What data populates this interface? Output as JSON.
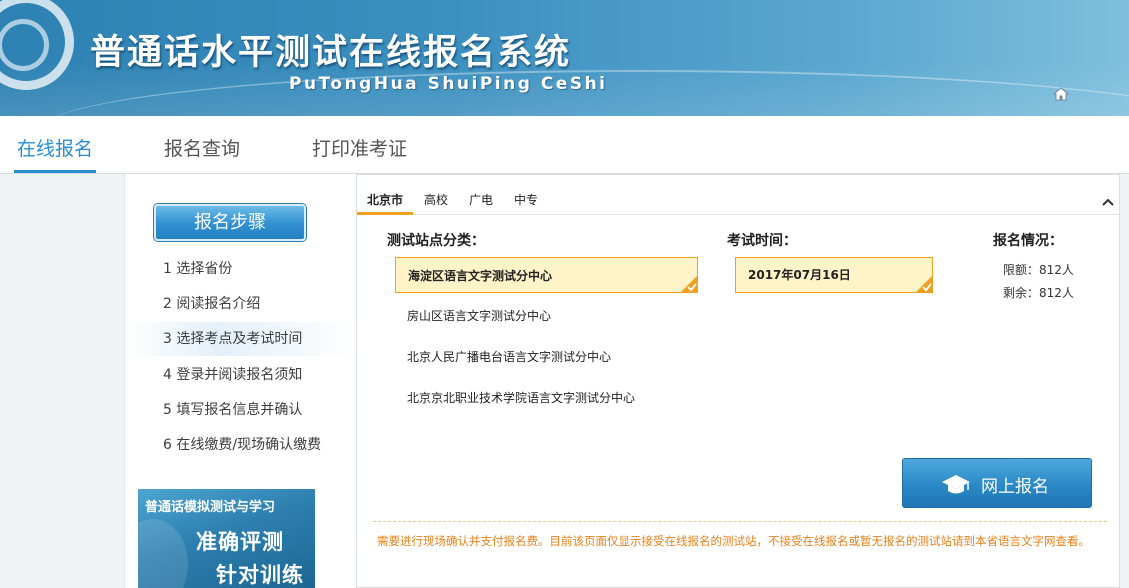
{
  "header": {
    "title": "普通话水平测试在线报名系统",
    "subtitle": "PuTongHua ShuiPing CeShi",
    "home_icon": "home-icon"
  },
  "nav": {
    "tabs": [
      {
        "label": "在线报名",
        "active": true
      },
      {
        "label": "报名查询",
        "active": false
      },
      {
        "label": "打印准考证",
        "active": false
      }
    ],
    "accent_color": "#2a8ed0"
  },
  "sidebar": {
    "steps_button": "报名步骤",
    "steps": [
      {
        "label": "1 选择省份",
        "active": false
      },
      {
        "label": "2 阅读报名介绍",
        "active": false
      },
      {
        "label": "3 选择考点及考试时间",
        "active": true
      },
      {
        "label": "4 登录并阅读报名须知",
        "active": false
      },
      {
        "label": "5 填写报名信息并确认",
        "active": false
      },
      {
        "label": "6 在线缴费/现场确认缴费",
        "active": false
      }
    ],
    "promo": {
      "top": "普通话模拟测试与学习",
      "line1": "准确评测",
      "line2": "针对训练"
    }
  },
  "main": {
    "region_tabs": [
      {
        "label": "北京市",
        "active": true
      },
      {
        "label": "高校",
        "active": false
      },
      {
        "label": "广电",
        "active": false
      },
      {
        "label": "中专",
        "active": false
      }
    ],
    "collapse_icon": "chevron-up-icon",
    "columns": {
      "site": "测试站点分类：",
      "time": "考试时间：",
      "status": "报名情况："
    },
    "sites": [
      {
        "name": "海淀区语言文字测试分中心",
        "selected": true
      },
      {
        "name": "房山区语言文字测试分中心",
        "selected": false
      },
      {
        "name": "北京人民广播电台语言文字测试分中心",
        "selected": false
      },
      {
        "name": "北京京北职业技术学院语言文字测试分中心",
        "selected": false
      }
    ],
    "date": {
      "value": "2017年07月16日",
      "selected": true
    },
    "quota": {
      "limit": "限额：812人",
      "remaining": "剩余：812人"
    },
    "apply_button": "网上报名",
    "notice": "需要进行现场确认并支付报名费。目前该页面仅显示接受在线报名的测试站，不接受在线报名或暂无报名的测试站请到本省语言文字网查看。",
    "selected_color": "#f0a020",
    "notice_color": "#e8801a"
  }
}
